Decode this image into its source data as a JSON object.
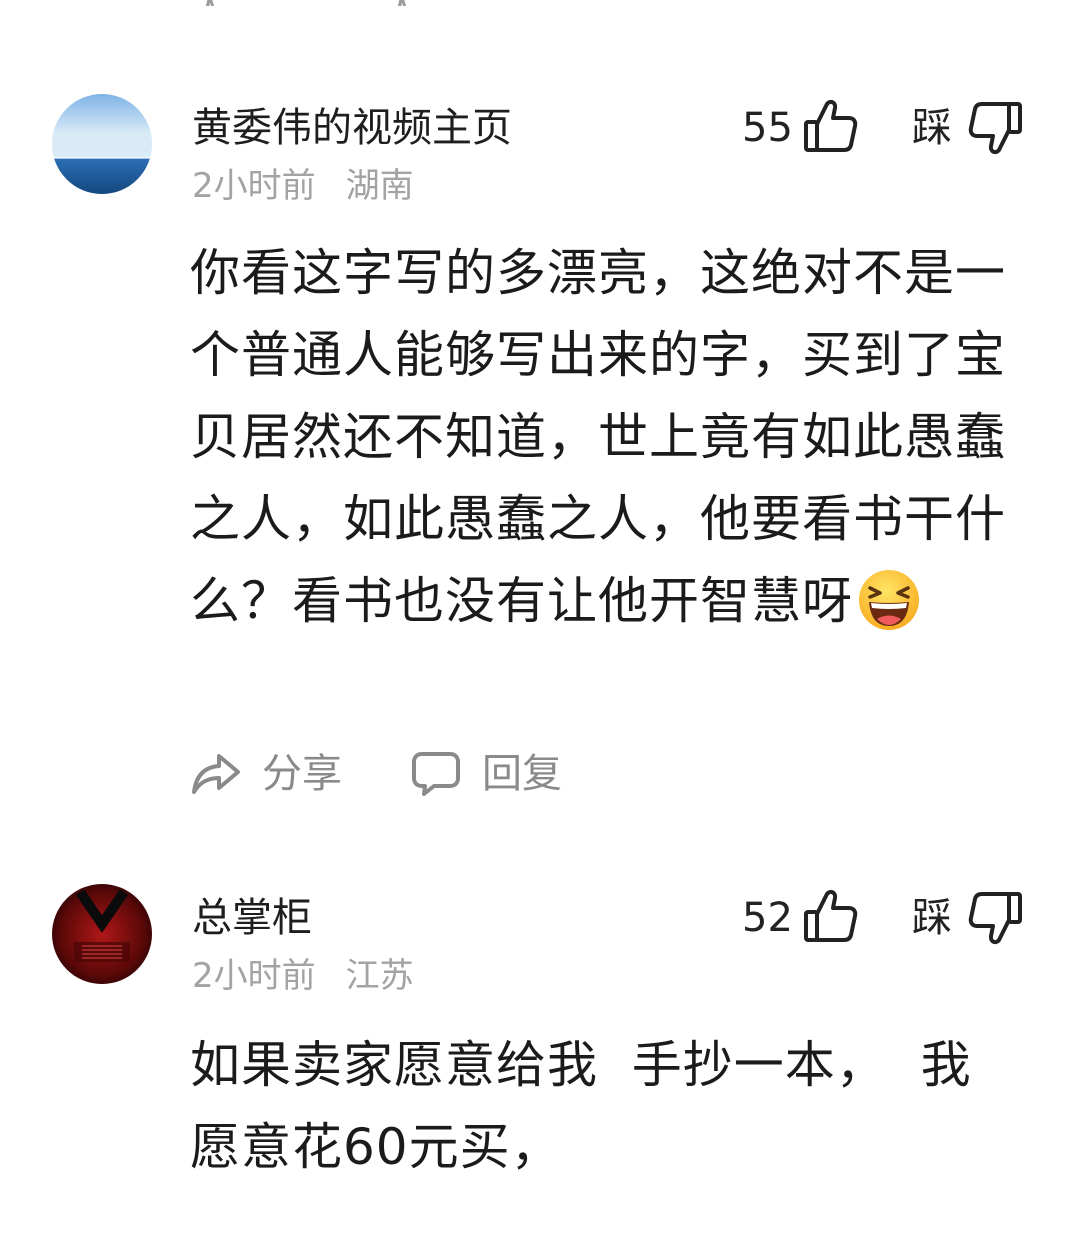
{
  "comments": [
    {
      "username": "黄委伟的视频主页",
      "time": "2小时前",
      "location": "湖南",
      "likes": "55",
      "dislike_label": "踩",
      "text": "你看这字写的多漂亮，这绝对不是一个普通人能够写出来的字，买到了宝贝居然还不知道，世上竟有如此愚蠢之人，如此愚蠢之人，他要看书干什么？看书也没有让他开智慧呀",
      "emoji": "laughing-emoji",
      "actions": {
        "share": "分享",
        "reply": "回复"
      },
      "avatar": "ocean-horizon"
    },
    {
      "username": "总掌柜",
      "time": "2小时前",
      "location": "江苏",
      "likes": "52",
      "dislike_label": "踩",
      "text": "如果卖家愿意给我  手抄一本，  我愿意花60元买，",
      "avatar": "dark-red-logo"
    }
  ],
  "icons": {
    "like": "thumbs-up-icon",
    "dislike": "thumbs-down-icon",
    "share": "share-icon",
    "reply": "comment-icon"
  },
  "colors": {
    "text": "#1b1b1b",
    "secondary": "#a3a3a3",
    "action": "#8a8a8a",
    "background": "#ffffff"
  }
}
